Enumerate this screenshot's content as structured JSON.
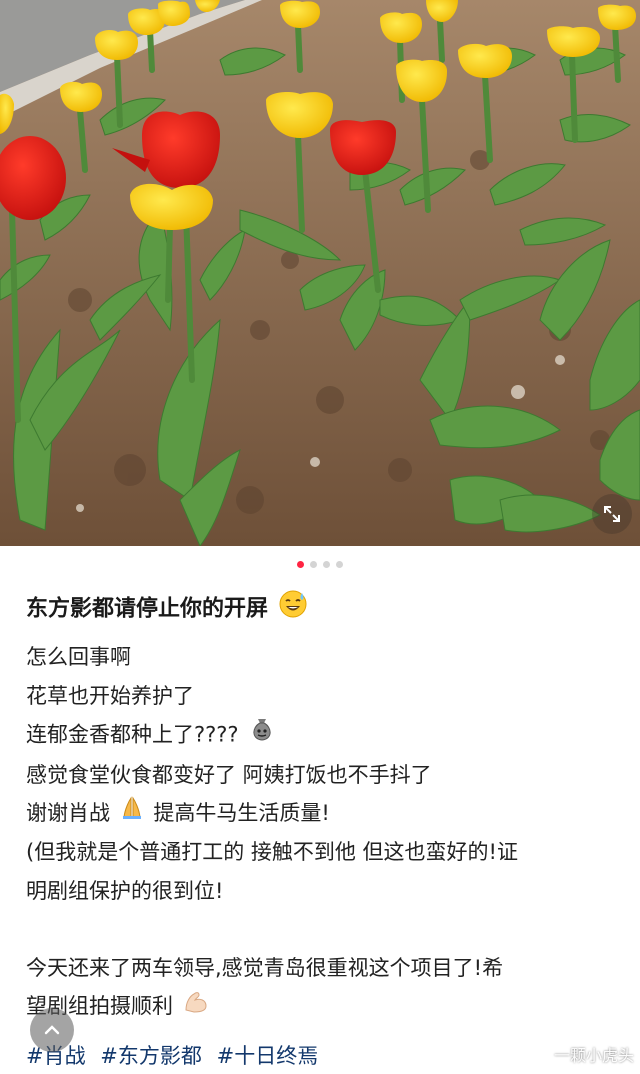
{
  "post": {
    "title": "东方影都请停止你的开屏",
    "title_emoji": "sweat-smile-icon",
    "lines": [
      "怎么回事啊",
      "花草也开始养护了",
      "连郁金香都种上了????",
      "感觉食堂伙食都变好了 阿姨打饭也不手抖了",
      "谢谢肖战",
      "提高牛马生活质量!",
      "(但我就是个普通打工的 接触不到他 但这也蛮好的!证",
      "明剧组保护的很到位!",
      "今天还来了两车领导,感觉青岛很重视这个项目了!希",
      "望剧组拍摄顺利"
    ],
    "tags": [
      "#肖战",
      "#东方影都",
      "#十日终焉"
    ]
  },
  "carousel": {
    "total": 4,
    "active_index": 0
  },
  "watermark": {
    "text": "一颗小虎头",
    "platform_icon": "weibo-icon"
  },
  "colors": {
    "accent": "#ff2442",
    "tag": "#13386c"
  }
}
